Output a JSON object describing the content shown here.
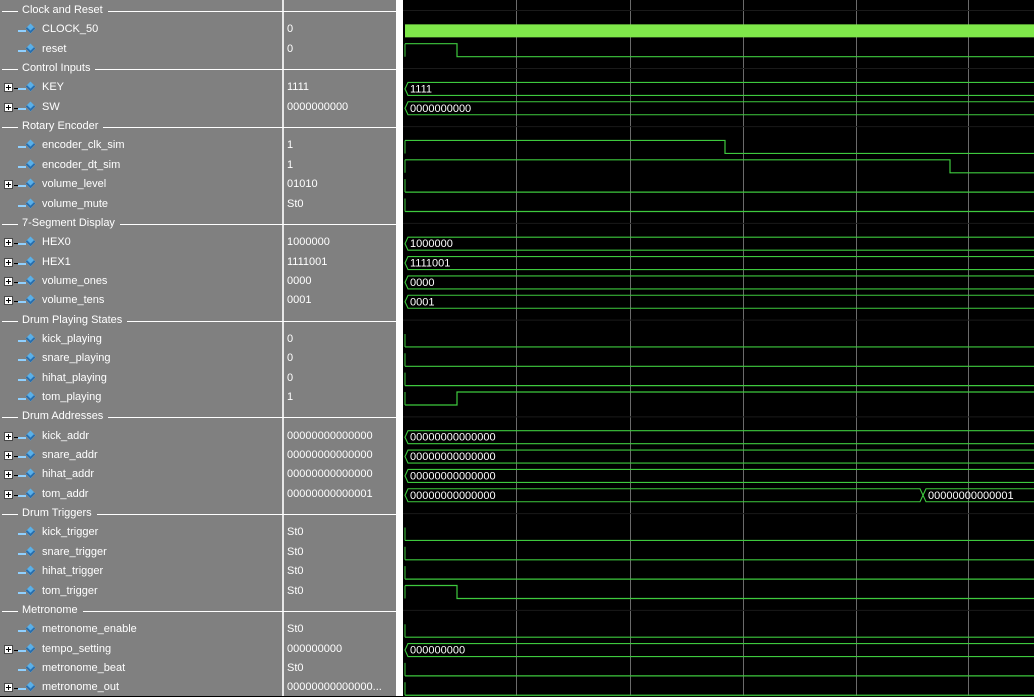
{
  "signals": [
    {
      "kind": "group",
      "label": "Clock and Reset"
    },
    {
      "kind": "sig",
      "name": "CLOCK_50",
      "value": "0",
      "expand": false,
      "wave": {
        "type": "clock"
      }
    },
    {
      "kind": "sig",
      "name": "reset",
      "value": "0",
      "expand": false,
      "wave": {
        "type": "bit",
        "edges": [
          {
            "t": 0,
            "v": 1
          },
          {
            "t": 52,
            "v": 0
          }
        ]
      }
    },
    {
      "kind": "group",
      "label": "Control Inputs"
    },
    {
      "kind": "sig",
      "name": "KEY",
      "value": "1111",
      "expand": true,
      "wave": {
        "type": "bus",
        "segments": [
          {
            "t": 0,
            "label": "1111"
          }
        ]
      }
    },
    {
      "kind": "sig",
      "name": "SW",
      "value": "0000000000",
      "expand": true,
      "wave": {
        "type": "bus",
        "segments": [
          {
            "t": 0,
            "label": "0000000000"
          }
        ]
      }
    },
    {
      "kind": "group",
      "label": "Rotary Encoder"
    },
    {
      "kind": "sig",
      "name": "encoder_clk_sim",
      "value": "1",
      "expand": false,
      "wave": {
        "type": "bit",
        "edges": [
          {
            "t": 0,
            "v": 1
          },
          {
            "t": 320,
            "v": 0
          }
        ]
      }
    },
    {
      "kind": "sig",
      "name": "encoder_dt_sim",
      "value": "1",
      "expand": false,
      "wave": {
        "type": "bit",
        "edges": [
          {
            "t": 0,
            "v": 1
          },
          {
            "t": 545,
            "v": 0
          }
        ]
      }
    },
    {
      "kind": "sig",
      "name": "volume_level",
      "value": "01010",
      "expand": true,
      "wave": {
        "type": "bit",
        "edges": [
          {
            "t": 0,
            "v": 0
          }
        ]
      }
    },
    {
      "kind": "sig",
      "name": "volume_mute",
      "value": "St0",
      "expand": false,
      "wave": {
        "type": "bit",
        "edges": [
          {
            "t": 0,
            "v": 0
          }
        ]
      }
    },
    {
      "kind": "group",
      "label": "7-Segment Display"
    },
    {
      "kind": "sig",
      "name": "HEX0",
      "value": "1000000",
      "expand": true,
      "wave": {
        "type": "bus",
        "segments": [
          {
            "t": 0,
            "label": "1000000"
          }
        ]
      }
    },
    {
      "kind": "sig",
      "name": "HEX1",
      "value": "1111001",
      "expand": true,
      "wave": {
        "type": "bus",
        "segments": [
          {
            "t": 0,
            "label": "1111001"
          }
        ]
      }
    },
    {
      "kind": "sig",
      "name": "volume_ones",
      "value": "0000",
      "expand": true,
      "wave": {
        "type": "bus",
        "segments": [
          {
            "t": 0,
            "label": "0000"
          }
        ]
      }
    },
    {
      "kind": "sig",
      "name": "volume_tens",
      "value": "0001",
      "expand": true,
      "wave": {
        "type": "bus",
        "segments": [
          {
            "t": 0,
            "label": "0001"
          }
        ]
      }
    },
    {
      "kind": "group",
      "label": "Drum Playing States"
    },
    {
      "kind": "sig",
      "name": "kick_playing",
      "value": "0",
      "expand": false,
      "wave": {
        "type": "bit",
        "edges": [
          {
            "t": 0,
            "v": 0
          }
        ]
      }
    },
    {
      "kind": "sig",
      "name": "snare_playing",
      "value": "0",
      "expand": false,
      "wave": {
        "type": "bit",
        "edges": [
          {
            "t": 0,
            "v": 0
          }
        ]
      }
    },
    {
      "kind": "sig",
      "name": "hihat_playing",
      "value": "0",
      "expand": false,
      "wave": {
        "type": "bit",
        "edges": [
          {
            "t": 0,
            "v": 0
          }
        ]
      }
    },
    {
      "kind": "sig",
      "name": "tom_playing",
      "value": "1",
      "expand": false,
      "wave": {
        "type": "bit",
        "edges": [
          {
            "t": 0,
            "v": 0
          },
          {
            "t": 52,
            "v": 1
          }
        ]
      }
    },
    {
      "kind": "group",
      "label": "Drum Addresses"
    },
    {
      "kind": "sig",
      "name": "kick_addr",
      "value": "00000000000000",
      "expand": true,
      "wave": {
        "type": "bus",
        "segments": [
          {
            "t": 0,
            "label": "00000000000000"
          }
        ]
      }
    },
    {
      "kind": "sig",
      "name": "snare_addr",
      "value": "00000000000000",
      "expand": true,
      "wave": {
        "type": "bus",
        "segments": [
          {
            "t": 0,
            "label": "00000000000000"
          }
        ]
      }
    },
    {
      "kind": "sig",
      "name": "hihat_addr",
      "value": "00000000000000",
      "expand": true,
      "wave": {
        "type": "bus",
        "segments": [
          {
            "t": 0,
            "label": "00000000000000"
          }
        ]
      }
    },
    {
      "kind": "sig",
      "name": "tom_addr",
      "value": "00000000000001",
      "expand": true,
      "wave": {
        "type": "bus",
        "segments": [
          {
            "t": 0,
            "label": "00000000000000"
          },
          {
            "t": 518,
            "label": "00000000000001"
          }
        ]
      }
    },
    {
      "kind": "group",
      "label": "Drum Triggers"
    },
    {
      "kind": "sig",
      "name": "kick_trigger",
      "value": "St0",
      "expand": false,
      "wave": {
        "type": "bit",
        "edges": [
          {
            "t": 0,
            "v": 0
          }
        ]
      }
    },
    {
      "kind": "sig",
      "name": "snare_trigger",
      "value": "St0",
      "expand": false,
      "wave": {
        "type": "bit",
        "edges": [
          {
            "t": 0,
            "v": 0
          }
        ]
      }
    },
    {
      "kind": "sig",
      "name": "hihat_trigger",
      "value": "St0",
      "expand": false,
      "wave": {
        "type": "bit",
        "edges": [
          {
            "t": 0,
            "v": 0
          }
        ]
      }
    },
    {
      "kind": "sig",
      "name": "tom_trigger",
      "value": "St0",
      "expand": false,
      "wave": {
        "type": "bit",
        "edges": [
          {
            "t": 0,
            "v": 1
          },
          {
            "t": 52,
            "v": 0
          }
        ]
      }
    },
    {
      "kind": "group",
      "label": "Metronome"
    },
    {
      "kind": "sig",
      "name": "metronome_enable",
      "value": "St0",
      "expand": false,
      "wave": {
        "type": "bit",
        "edges": [
          {
            "t": 0,
            "v": 0
          }
        ]
      }
    },
    {
      "kind": "sig",
      "name": "tempo_setting",
      "value": "000000000",
      "expand": true,
      "wave": {
        "type": "bus",
        "segments": [
          {
            "t": 0,
            "label": "000000000"
          }
        ]
      }
    },
    {
      "kind": "sig",
      "name": "metronome_beat",
      "value": "St0",
      "expand": false,
      "wave": {
        "type": "bit",
        "edges": [
          {
            "t": 0,
            "v": 0
          }
        ]
      }
    },
    {
      "kind": "sig",
      "name": "metronome_out",
      "value": "00000000000000...",
      "expand": true,
      "wave": {
        "type": "bit",
        "edges": [
          {
            "t": 0,
            "v": 0
          }
        ]
      }
    }
  ],
  "colors": {
    "wave": "#3ec93e",
    "clock_fill": "#7fe84a",
    "bus_text": "#ffffff",
    "grid": "#6a6a6a",
    "background": "#000000",
    "signal_pane": "#808080"
  }
}
